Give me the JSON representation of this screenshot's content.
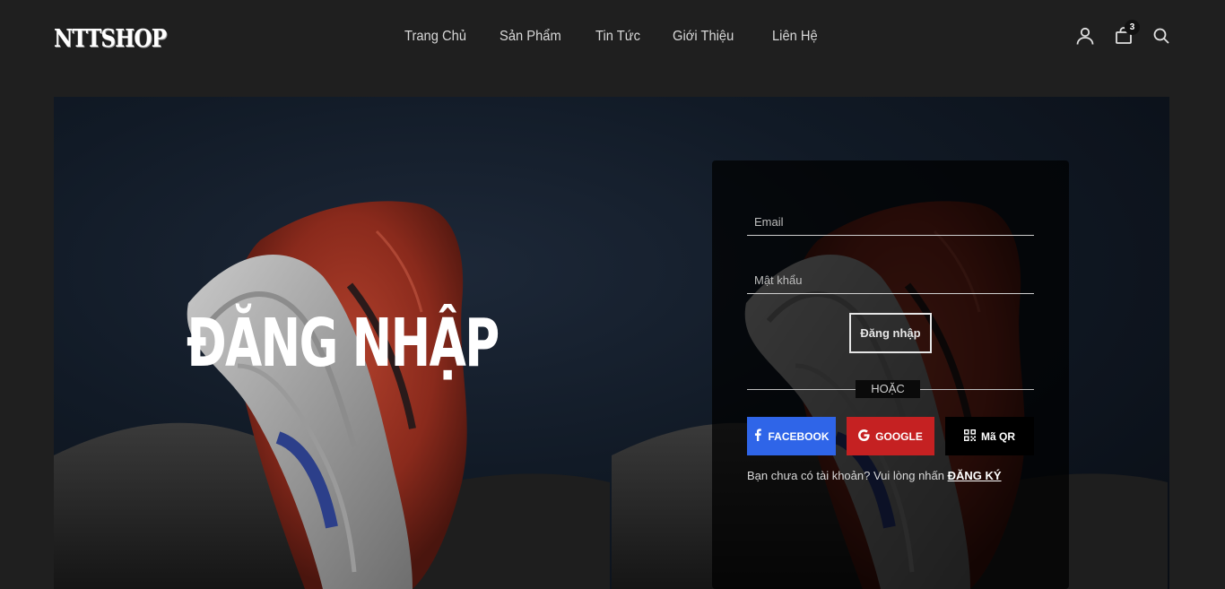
{
  "header": {
    "logo": "NTTSHOP",
    "nav": [
      "Trang Chủ",
      "Sản Phẩm",
      "Tin Tức",
      "Giới Thiệu",
      "Liên Hệ"
    ],
    "cart_count": "3",
    "icons": [
      "user-icon",
      "shopping-bag-icon",
      "search-icon"
    ]
  },
  "hero": {
    "title": "ĐĂNG NHẬP"
  },
  "login_form": {
    "email_placeholder": "Email",
    "password_placeholder": "Mật khẩu",
    "submit_label": "Đăng nhập",
    "divider_label": "HOẶC",
    "facebook_label": "FACEBOOK",
    "google_label": "GOOGLE",
    "qr_label": "Mã QR",
    "register_prompt": "Bạn chưa có tài khoản? Vui lòng nhấn",
    "register_link": "ĐĂNG KÝ"
  },
  "colors": {
    "background": "#1f1f1f",
    "facebook": "#2f65e8",
    "google": "#c52122",
    "qr": "#000000"
  }
}
